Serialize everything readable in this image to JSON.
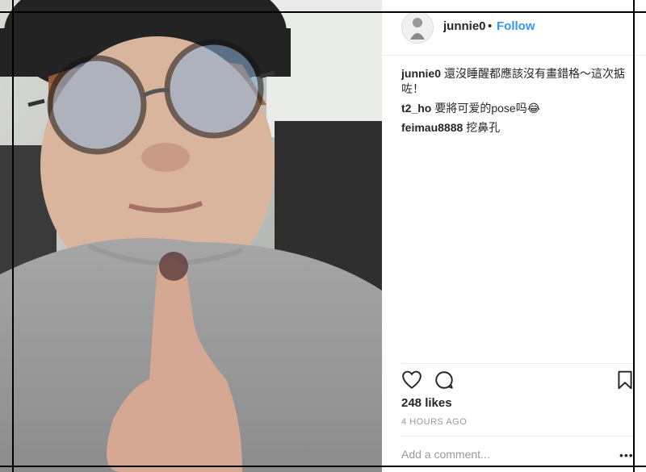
{
  "header": {
    "username": "junnie0",
    "dot": "•",
    "follow_label": "Follow"
  },
  "comments": [
    {
      "user": "junnie0",
      "text": "還沒睡醒都應該沒有畫錯格～這次掂咗！"
    },
    {
      "user": "t2_ho",
      "text": "要將可爱的pose吗😂"
    },
    {
      "user": "feimau8888",
      "text": "挖鼻孔"
    }
  ],
  "actions": {
    "like_icon": "heart-icon",
    "comment_icon": "speech-bubble-icon",
    "save_icon": "bookmark-icon"
  },
  "likes": "248 likes",
  "timestamp": "4 HOURS AGO",
  "add_comment": {
    "placeholder": "Add a comment..."
  },
  "more_label": "•••",
  "colors": {
    "accent": "#3897f0",
    "text": "#262626",
    "muted": "#999999",
    "border": "#efefef"
  }
}
